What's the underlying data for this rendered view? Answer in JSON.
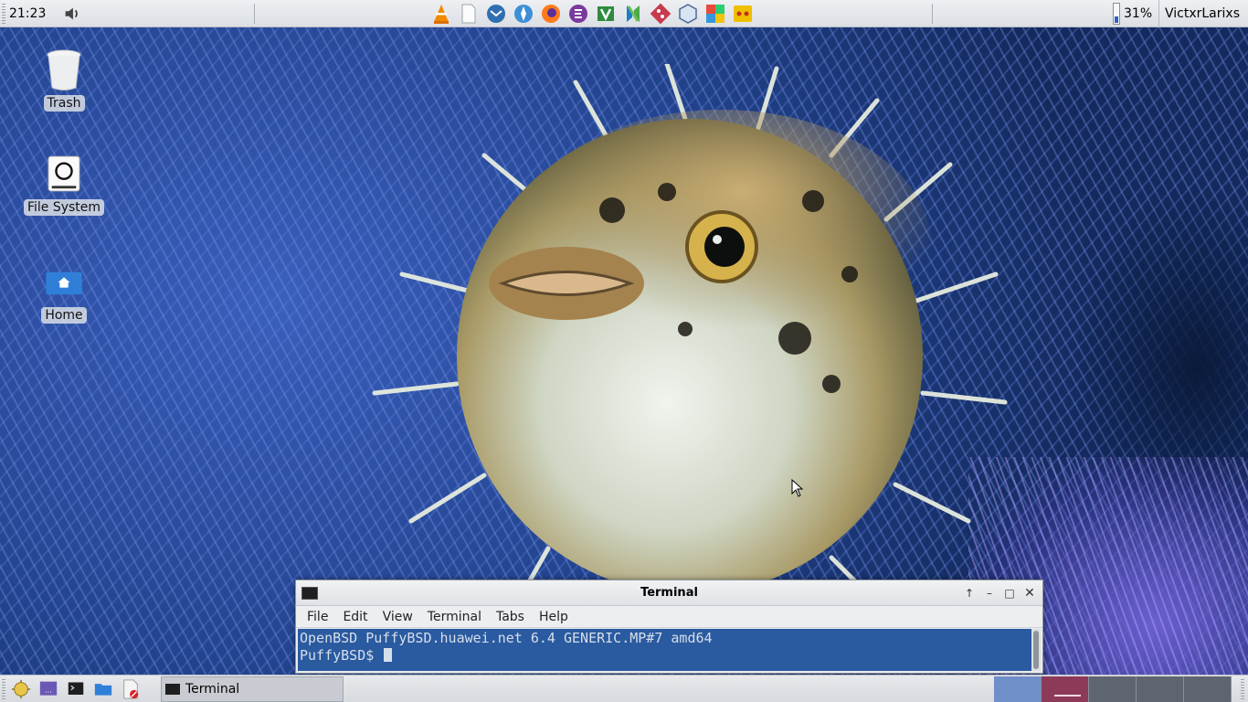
{
  "top_panel": {
    "clock": "21:23",
    "battery_percent": 31,
    "battery_text": "31%",
    "user": "VictxrLarixs",
    "launchers": [
      "vlc-icon",
      "text-editor-icon",
      "mail-icon",
      "browser-compass-icon",
      "firefox-icon",
      "emacs-icon",
      "vim-icon",
      "neovim-icon",
      "git-icon",
      "box-icon",
      "mosaic-icon",
      "media-player-icon"
    ]
  },
  "desktop": {
    "icons": [
      {
        "name": "trash-icon",
        "label": "Trash"
      },
      {
        "name": "file-system-icon",
        "label": "File System"
      },
      {
        "name": "home-icon",
        "label": "Home"
      }
    ]
  },
  "terminal": {
    "title": "Terminal",
    "menu": [
      "File",
      "Edit",
      "View",
      "Terminal",
      "Tabs",
      "Help"
    ],
    "lines": [
      "OpenBSD PuffyBSD.huawei.net 6.4 GENERIC.MP#7 amd64",
      "PuffyBSD$ "
    ]
  },
  "bottom_panel": {
    "task_label": "Terminal",
    "workspace_count": 5,
    "active_workspace": 1
  },
  "colors": {
    "terminal_bg": "#2a5aa0",
    "accent": "#2f5fc7"
  }
}
